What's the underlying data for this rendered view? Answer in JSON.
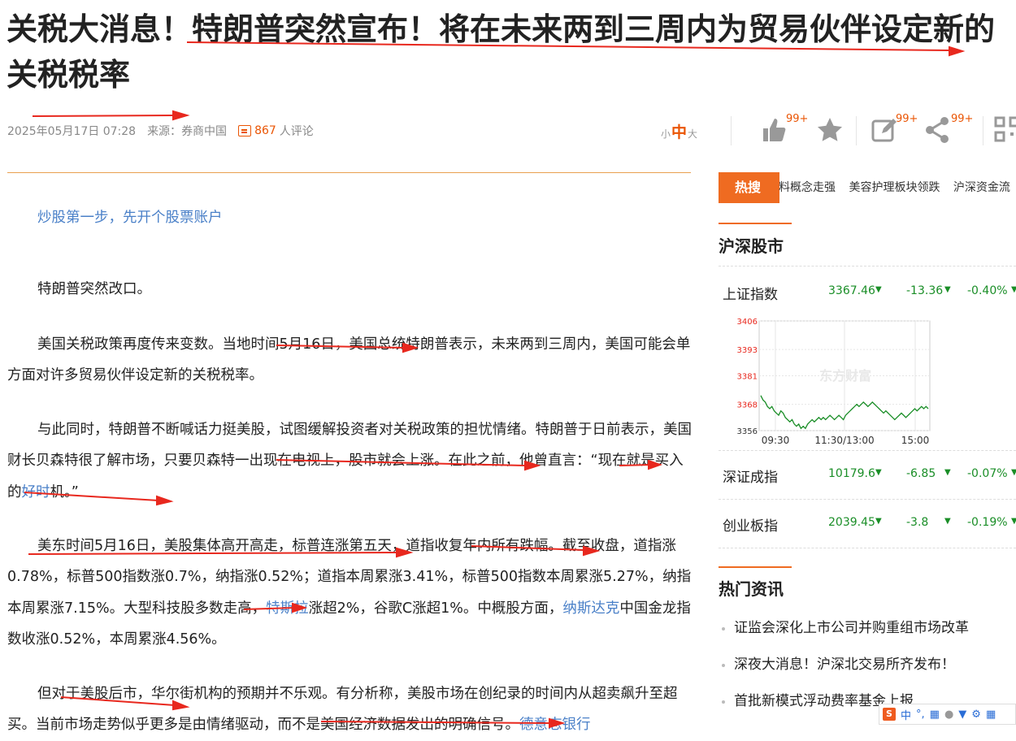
{
  "article": {
    "title": "关税大消息！特朗普突然宣布！将在未来两到三周内为贸易伙伴设定新的关税税率",
    "date": "2025年05月17日 07:28",
    "source_label": "来源：",
    "source": "券商中国",
    "comment_count": "867",
    "comment_suffix": "人评论",
    "promo_link": "炒股第一步，先开个股票账户",
    "paragraphs": [
      {
        "text": "特朗普突然改口。"
      },
      {
        "text": "美国关税政策再度传来变数。当地时间5月16日，美国总统特朗普表示，未来两到三周内，美国可能会单方面对许多贸易伙伴设定新的关税税率。"
      },
      {
        "pre": "与此同时，特朗普不断喊话力挺美股，试图缓解投资者对关税政策的担忧情绪。特朗普于日前表示，美国财长贝森特很了解市场，只要贝森特一出现在电视上，股市就会上涨。在此之前，他曾直言：“现在就是买入的",
        "link": "好时",
        "post": "机。”"
      },
      {
        "pre": "美东时间5月16日，美股集体高开高走，标普连涨第五天，道指收复年内所有跌幅。截至收盘，道指涨0.78%，标普500指数涨0.7%，纳指涨0.52%；道指本周累涨3.41%，标普500指数本周累涨5.27%，纳指本周累涨7.15%。大型科技股多数走高，",
        "link": "特斯拉",
        "post": "涨超2%，谷歌C涨超1%。中概股方面，",
        "link2": "纳斯达克",
        "post2": "中国金龙指数收涨0.52%，本周累涨4.56%。"
      },
      {
        "pre": "但对于美股后市，华尔街机构的预期并不乐观。有分析称，美股市场在创纪录的时间内从超卖飙升至超买。当前市场走势似乎更多是由情绪驱动，而不是美国经济数据发出的明确信号。",
        "link": "德意志银行"
      }
    ]
  },
  "toolbar": {
    "font_small": "小",
    "font_mid": "中",
    "font_large": "大",
    "like_badge": "99+",
    "edit_badge": "99+",
    "share_badge": "99+"
  },
  "sidebar": {
    "hot_label": "热搜",
    "hot_items": [
      "料概念走强",
      "美容护理板块领跌",
      "沪深资金流"
    ],
    "market_title": "沪深股市",
    "indices": [
      {
        "name": "上证指数",
        "value": "3367.46",
        "change": "-13.36",
        "pct": "-0.40%"
      },
      {
        "name": "深证成指",
        "value": "10179.6",
        "change": "-6.85",
        "pct": "-0.07%"
      },
      {
        "name": "创业板指",
        "value": "2039.45",
        "change": "-3.8",
        "pct": "-0.19%"
      }
    ],
    "news_title": "热门资讯",
    "news": [
      "证监会深化上市公司并购重组市场改革",
      "深夜大消息！沪深北交易所齐发布！",
      "首批新模式浮动费率基金上报"
    ]
  },
  "chart_data": {
    "type": "line",
    "title": "",
    "watermark": "东方财富",
    "x_ticks": [
      "09:30",
      "11:30/13:00",
      "15:00"
    ],
    "y_ticks": [
      3356,
      3368,
      3381,
      3393,
      3406
    ],
    "ylim": [
      3356,
      3406
    ],
    "series": [
      {
        "values": [
          3372,
          3370,
          3369,
          3367,
          3366,
          3367,
          3365,
          3364,
          3363,
          3365,
          3364,
          3362,
          3361,
          3360,
          3361,
          3359,
          3358,
          3359,
          3357,
          3358,
          3357,
          3359,
          3360,
          3361,
          3360,
          3361,
          3362,
          3361,
          3362,
          3361,
          3362,
          3363,
          3362,
          3361,
          3362,
          3363,
          3362,
          3361,
          3363,
          3364,
          3365,
          3366,
          3367,
          3368,
          3367,
          3368,
          3369,
          3368,
          3367,
          3368,
          3369,
          3368,
          3367,
          3366,
          3365,
          3364,
          3365,
          3364,
          3363,
          3362,
          3361,
          3362,
          3363,
          3364,
          3363,
          3362,
          3363,
          3364,
          3365,
          3366,
          3365,
          3366,
          3367,
          3366,
          3367,
          3366
        ]
      }
    ],
    "color": "#1a8e27"
  },
  "ime": {
    "label": "中"
  }
}
